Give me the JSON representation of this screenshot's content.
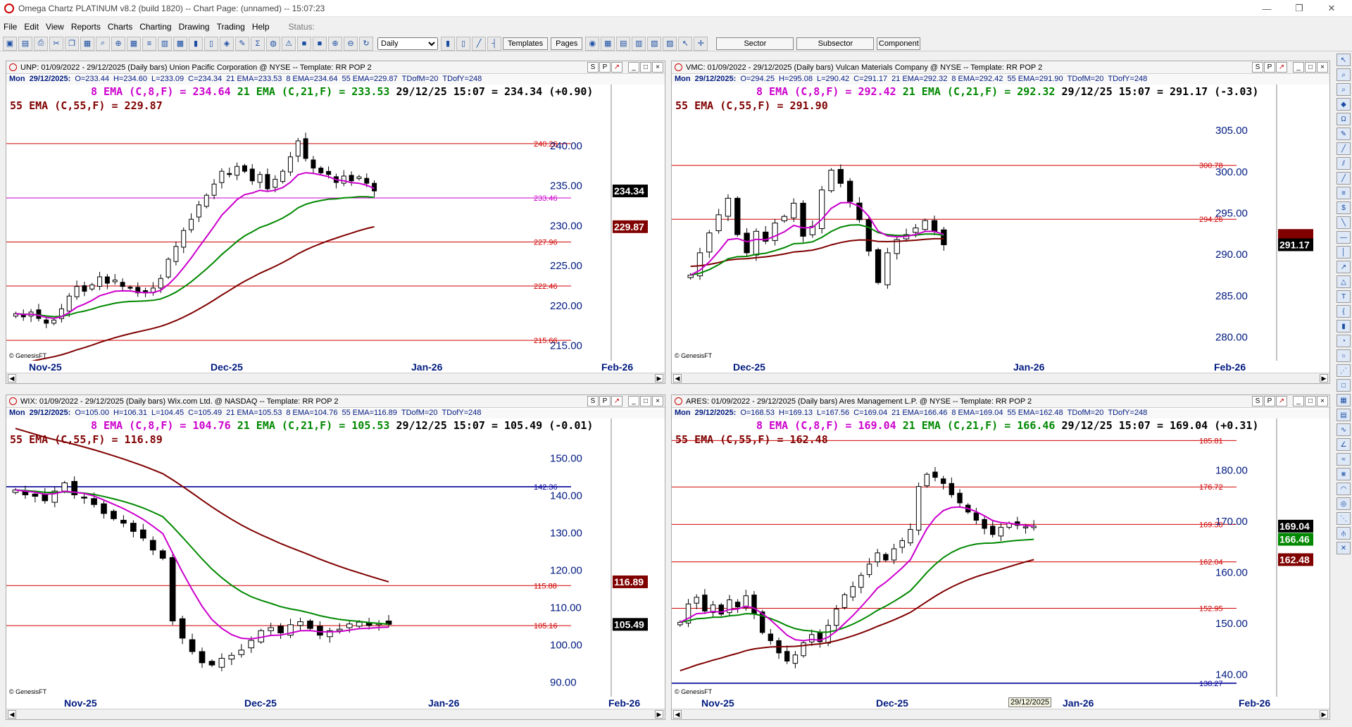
{
  "window": {
    "title": "Omega Chartz PLATINUM v8.2 (build 1820)  --  Chart Page: (unnamed) -- 15:07:23"
  },
  "menu": [
    "File",
    "Edit",
    "View",
    "Reports",
    "Charts",
    "Charting",
    "Drawing",
    "Trading",
    "Help"
  ],
  "status_label": "Status:",
  "toolbar": {
    "period": "Daily",
    "buttons": [
      "Templates",
      "Pages"
    ],
    "wide_buttons": [
      "Sector",
      "Subsector",
      "Component"
    ]
  },
  "pane_buttons": [
    "S",
    "P",
    "↗",
    "_",
    "□",
    "×"
  ],
  "copyright": "© GenesisFT",
  "colors": {
    "ema8": "#cc00cc",
    "ema21": "#008800",
    "ema55": "#800000",
    "level": "#d00000",
    "level_blue": "#000099"
  },
  "panes": [
    {
      "header": "UNP:  01/09/2022 - 29/12/2025  (Daily bars)  Union Pacific Corporation @ NYSE  --  Template: RR POP 2",
      "info": [
        "Mon",
        "29/12/2025:",
        "O=233.44",
        "H=234.60",
        "L=233.09",
        "C=234.34",
        "21 EMA=233.53",
        "8 EMA=234.64",
        "55 EMA=229.87",
        "TDofM=20",
        "TDofY=248"
      ],
      "line1": {
        "e8": "8 EMA (C,8,F) = 234.64",
        "e21": "21 EMA (C,21,F) = 233.53",
        "px": "29/12/25 15:07 = 234.34 (+0.90)"
      },
      "line2": "55 EMA (C,55,F) = 229.87",
      "ymin": 214,
      "ymax": 245,
      "ticks": [
        "215.00",
        "220.00",
        "225.00",
        "230.00",
        "235.00",
        "240.00"
      ],
      "tick_vals": [
        215,
        220,
        225,
        230,
        235,
        240
      ],
      "levels": [
        {
          "v": 240.26,
          "t": "240.26",
          "c": "red"
        },
        {
          "v": 233.46,
          "t": "233.46",
          "c": "magenta"
        },
        {
          "v": 227.96,
          "t": "227.96",
          "c": "red"
        },
        {
          "v": 222.46,
          "t": "222.46",
          "c": "red"
        },
        {
          "v": 215.66,
          "t": "215.66",
          "c": "red"
        }
      ],
      "tags": [
        {
          "v": 234.34,
          "t": "234.34",
          "bg": "#000000"
        },
        {
          "v": 229.87,
          "t": "229.87",
          "bg": "#800000"
        }
      ],
      "xlabels": [
        "Nov-25",
        "Dec-25",
        "Jan-26",
        "Feb-26"
      ],
      "closes": [
        219,
        218.6,
        219.2,
        218.4,
        217.8,
        218.2,
        219.6,
        221.2,
        222.4,
        221.8,
        222.6,
        223.6,
        222.8,
        223.2,
        222.4,
        222.2,
        221.6,
        221.8,
        222.2,
        223.4,
        225.8,
        227.4,
        229.4,
        230.8,
        232.6,
        233.8,
        235.2,
        236.8,
        236.4,
        237.4,
        236.8,
        235.6,
        236.4,
        234.6,
        235.8,
        236.8,
        238.6,
        240.6,
        238.4,
        237.2,
        236.6,
        236.4,
        235.4,
        236.2,
        235.6,
        236.1,
        235.3,
        234.34
      ],
      "ema8_end": 234.64,
      "ema21_end": 233.53,
      "ema55_end": 229.87
    },
    {
      "header": "VMC:  01/09/2022 - 29/12/2025  (Daily bars)  Vulcan Materials Company @ NYSE  --  Template: RR POP 2",
      "info": [
        "Mon",
        "29/12/2025:",
        "O=294.25",
        "H=295.08",
        "L=290.42",
        "C=291.17",
        "21 EMA=292.32",
        "8 EMA=292.42",
        "55 EMA=291.90",
        "TDofM=20",
        "TDofY=248"
      ],
      "line1": {
        "e8": "8 EMA (C,8,F) = 292.42",
        "e21": "21 EMA (C,21,F) = 292.32",
        "px": "29/12/25 15:07 = 291.17 (-3.03)"
      },
      "line2": "55 EMA (C,55,F) = 291.90",
      "ymin": 278,
      "ymax": 308,
      "ticks": [
        "280.00",
        "285.00",
        "290.00",
        "295.00",
        "300.00",
        "305.00"
      ],
      "tick_vals": [
        280,
        285,
        290,
        295,
        300,
        305
      ],
      "levels": [
        {
          "v": 300.78,
          "t": "300.78",
          "c": "red"
        },
        {
          "v": 294.26,
          "t": "294.26",
          "c": "red"
        }
      ],
      "tags": [
        {
          "v": 292.3,
          "t": "",
          "bg": "#800000"
        },
        {
          "v": 291.17,
          "t": "291.17",
          "bg": "#000000"
        }
      ],
      "xlabels": [
        "Dec-25",
        "Jan-26",
        "Feb-26"
      ],
      "closes": [
        287.5,
        290.2,
        292.6,
        294.8,
        296.8,
        292.4,
        290.2,
        292.8,
        291.6,
        293.8,
        294.6,
        296.2,
        292.2,
        293.4,
        297.8,
        300.2,
        298.6,
        296.4,
        294.2,
        290.4,
        286.6,
        290.2,
        291.8,
        292.4,
        293.2,
        294.1,
        292.8,
        291.17
      ],
      "ema8_end": 292.42,
      "ema21_end": 292.32,
      "ema55_end": 291.9
    },
    {
      "header": "WIX:  01/09/2022 - 29/12/2025  (Daily bars)  Wix.com Ltd. @ NASDAQ  --  Template: RR POP 2",
      "info": [
        "Mon",
        "29/12/2025:",
        "O=105.00",
        "H=106.31",
        "L=104.45",
        "C=105.49",
        "21 EMA=105.53",
        "8 EMA=104.76",
        "55 EMA=116.89",
        "TDofM=20",
        "TDofY=248"
      ],
      "line1": {
        "e8": "8 EMA (C,8,F) = 104.76",
        "e21": "21 EMA (C,21,F) = 105.53",
        "px": "29/12/25 15:07 = 105.49 (-0.01)"
      },
      "line2": "55 EMA (C,55,F) = 116.89",
      "ymin": 88,
      "ymax": 155,
      "ticks": [
        "90.00",
        "100.00",
        "110.00",
        "120.00",
        "130.00",
        "140.00",
        "150.00"
      ],
      "tick_vals": [
        90,
        100,
        110,
        120,
        130,
        140,
        150
      ],
      "levels": [
        {
          "v": 142.36,
          "t": "142.36",
          "c": "blue"
        },
        {
          "v": 115.88,
          "t": "115.88",
          "c": "red"
        },
        {
          "v": 105.16,
          "t": "105.16",
          "c": "red"
        }
      ],
      "tags": [
        {
          "v": 116.89,
          "t": "116.89",
          "bg": "#800000"
        },
        {
          "v": 105.49,
          "t": "105.49",
          "bg": "#000000"
        }
      ],
      "xlabels": [
        "Nov-25",
        "Dec-25",
        "Jan-26",
        "Feb-26"
      ],
      "closes": [
        141.5,
        140.2,
        139.8,
        138.6,
        141.2,
        143.4,
        140.2,
        139.4,
        137.6,
        135.2,
        133.8,
        132.6,
        130.4,
        128.6,
        125.4,
        123.2,
        106.4,
        101.8,
        98.2,
        95.2,
        94.6,
        96.4,
        97.2,
        98.6,
        101.2,
        103.8,
        104.6,
        103.2,
        105.4,
        106.2,
        104.4,
        102.6,
        103.8,
        104.2,
        105.6,
        106.1,
        105.2,
        105.8,
        105.49
      ],
      "ema8_end": 104.76,
      "ema21_end": 105.53,
      "ema55_end": 116.89
    },
    {
      "header": "ARES:  01/09/2022 - 29/12/2025  (Daily bars)  Ares Management L.P. @ NYSE  --  Template: RR POP 2",
      "info": [
        "Mon",
        "29/12/2025:",
        "O=168.53",
        "H=169.13",
        "L=167.56",
        "C=169.04",
        "21 EMA=166.46",
        "8 EMA=169.04",
        "55 EMA=162.48",
        "TDofM=20",
        "TDofY=248"
      ],
      "line1": {
        "e8": "8 EMA (C,8,F) = 169.04",
        "e21": "21 EMA (C,21,F) = 166.46",
        "px": "29/12/25 15:07 = 169.04 (+0.31)"
      },
      "line2": "55 EMA (C,55,F) = 162.48",
      "extra_level_text": "185.81",
      "ymin": 137,
      "ymax": 186,
      "ticks": [
        "140.00",
        "150.00",
        "160.00",
        "170.00",
        "180.00"
      ],
      "tick_vals": [
        140,
        150,
        160,
        170,
        180
      ],
      "levels": [
        {
          "v": 185.81,
          "t": "185.81",
          "c": "red"
        },
        {
          "v": 176.72,
          "t": "176.72",
          "c": "red"
        },
        {
          "v": 169.38,
          "t": "169.38",
          "c": "red"
        },
        {
          "v": 162.04,
          "t": "162.04",
          "c": "red"
        },
        {
          "v": 152.95,
          "t": "152.95",
          "c": "red"
        },
        {
          "v": 138.27,
          "t": "138.27",
          "c": "blue"
        }
      ],
      "tags": [
        {
          "v": 169.04,
          "t": "169.04",
          "bg": "#000000"
        },
        {
          "v": 166.46,
          "t": "166.46",
          "bg": "#008800"
        },
        {
          "v": 162.48,
          "t": "162.48",
          "bg": "#800000"
        }
      ],
      "xlabels": [
        "Nov-25",
        "Dec-25",
        "Jan-26",
        "Feb-26"
      ],
      "date_box": "29/12/2025",
      "closes": [
        150.2,
        153.8,
        155.1,
        152.4,
        153.6,
        151.8,
        154.6,
        153.2,
        155.4,
        151.8,
        148.2,
        146.6,
        144.2,
        142.6,
        143.8,
        146.2,
        147.8,
        146.4,
        149.6,
        152.8,
        155.6,
        157.2,
        159.4,
        161.6,
        163.8,
        162.4,
        164.6,
        166.2,
        168.4,
        176.8,
        179.2,
        178.6,
        177.4,
        175.2,
        173.6,
        171.8,
        170.2,
        168.6,
        167.4,
        168.8,
        169.6,
        169.2,
        168.9,
        169.04
      ],
      "ema8_end": 169.04,
      "ema21_end": 166.46,
      "ema55_end": 162.48
    }
  ]
}
